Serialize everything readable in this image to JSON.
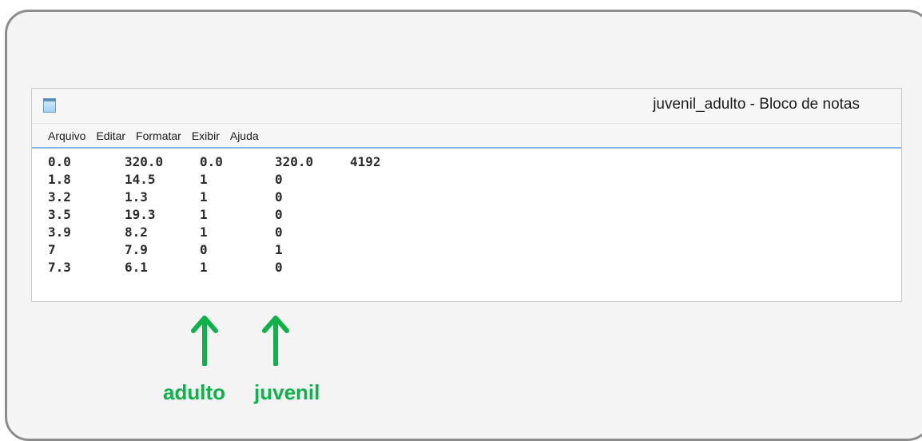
{
  "window": {
    "title": "juvenil_adulto - Bloco de notas",
    "icon": "notepad-icon"
  },
  "menu": [
    "Arquivo",
    "Editar",
    "Formatar",
    "Exibir",
    "Ajuda"
  ],
  "rows": [
    [
      "0.0",
      "320.0",
      "0.0",
      "320.0",
      "4192"
    ],
    [
      "1.8",
      "14.5",
      "1",
      "0"
    ],
    [
      "3.2",
      "1.3",
      "1",
      "0"
    ],
    [
      "3.5",
      "19.3",
      "1",
      "0"
    ],
    [
      "3.9",
      "8.2",
      "1",
      "0"
    ],
    [
      "7",
      "7.9",
      "0",
      "1"
    ],
    [
      "7.3",
      "6.1",
      "1",
      "0"
    ]
  ],
  "annotations": {
    "adulto": "adulto",
    "juvenil": "juvenil",
    "color": "#0fb14b",
    "arrow_icon": "up-arrow-icon"
  }
}
